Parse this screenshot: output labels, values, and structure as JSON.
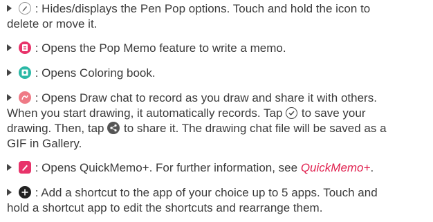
{
  "items": [
    {
      "icon": "pen-pop-icon",
      "lines": [
        ": Hides/displays the Pen Pop options. Touch and hold the icon to",
        "delete or move it."
      ]
    },
    {
      "icon": "pop-memo-icon",
      "lines": [
        ": Opens the Pop Memo feature to write a memo."
      ]
    },
    {
      "icon": "coloring-book-icon",
      "lines": [
        ": Opens Coloring book."
      ]
    },
    {
      "icon": "draw-chat-icon",
      "line1": ": Opens Draw chat to record as you draw and share it with others.",
      "line2": "When you start drawing, it automatically records. Tap",
      "line2b": "to save your",
      "line3a": "drawing. Then, tap",
      "line3b": "to share it. The drawing chat file will be saved as a",
      "line4": "GIF in Gallery."
    },
    {
      "icon": "quickmemo-icon",
      "text": ": Opens QuickMemo+. For further information, see",
      "link": "QuickMemo+",
      "after": "."
    },
    {
      "icon": "add-shortcut-icon",
      "lines": [
        ": Add a shortcut to the app of your choice up to 5 apps. Touch and",
        "hold a shortcut app to edit the shortcuts and rearrange them."
      ]
    }
  ],
  "colors": {
    "text": "#3a3a3a",
    "link": "#e0204e",
    "pop_memo": "#e8336a",
    "coloring_book": "#2bb8a6",
    "draw_chat": "#ef7a86",
    "quickmemo": "#e8336a",
    "add_shortcut": "#222222"
  }
}
